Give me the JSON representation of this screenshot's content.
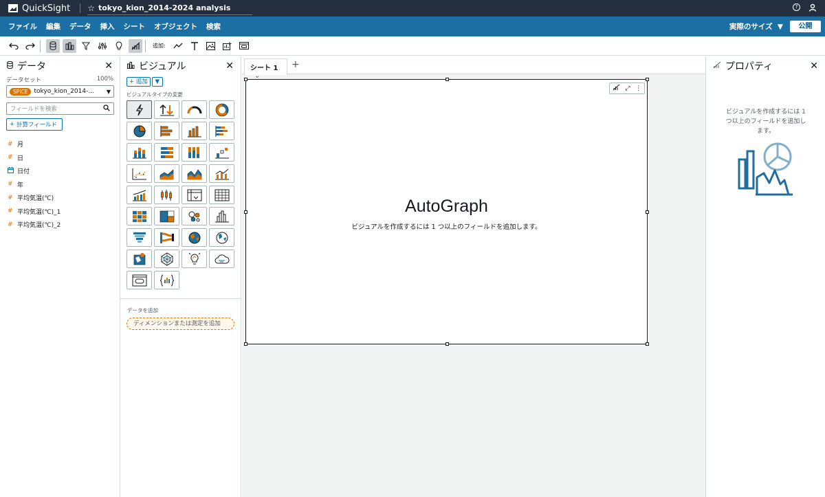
{
  "topbar": {
    "app_name": "QuickSight",
    "analysis_title": "tokyo_kion_2014-2024 analysis",
    "icons": [
      "help-icon",
      "user-icon"
    ]
  },
  "menubar": {
    "items": [
      "ファイル",
      "編集",
      "データ",
      "挿入",
      "シート",
      "オブジェクト",
      "検索"
    ],
    "size_label": "実際のサイズ",
    "publish_label": "公開"
  },
  "toolbar": {
    "add_label": "追加:"
  },
  "data_panel": {
    "title": "データ",
    "dataset_label": "データセット",
    "dataset_percent": "100%",
    "spice_badge": "SPICE",
    "dataset_name": "tokyo_kion_2014-...",
    "search_placeholder": "フィールドを検索",
    "calc_field_label": "計算フィールド",
    "fields": [
      {
        "type": "#",
        "name": "月"
      },
      {
        "type": "#",
        "name": "日"
      },
      {
        "type": "date",
        "name": "日付"
      },
      {
        "type": "#",
        "name": "年"
      },
      {
        "type": "#",
        "name": "平均気温(℃)"
      },
      {
        "type": "#",
        "name": "平均気温(℃)_1"
      },
      {
        "type": "#",
        "name": "平均気温(℃)_2"
      }
    ]
  },
  "visual_panel": {
    "title": "ビジュアル",
    "add_label": "+ 追加",
    "vtype_label": "ビジュアルタイプの変更",
    "add_data_label": "データを追加",
    "dimension_placeholder": "ディメンションまたは測定を追加"
  },
  "canvas": {
    "sheet_tab": "シート 1",
    "visual_title": "AutoGraph",
    "visual_message": "ビジュアルを作成するには 1 つ以上のフィールドを追加します。"
  },
  "props_panel": {
    "title": "プロパティ",
    "message": "ビジュアルを作成するには 1 つ以上のフィールドを追加します。"
  },
  "colors": {
    "topbar": "#232f3e",
    "menubar": "#1b6fa3",
    "accent_orange": "#d97400",
    "link_blue": "#0073bb",
    "illustration_blue": "#1f6e9c",
    "illustration_light": "#7fb0c9"
  }
}
